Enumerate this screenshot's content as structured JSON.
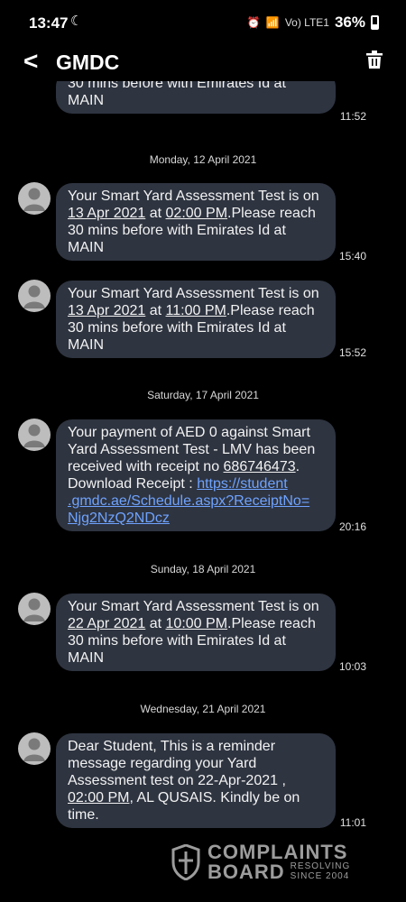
{
  "status": {
    "time": "13:47",
    "network": "Vo) LTE1",
    "battery": "36%"
  },
  "header": {
    "title": "GMDC"
  },
  "messages": [
    {
      "type": "message",
      "parts": [
        "30 mins before with Emirates Id at\nMAIN"
      ],
      "time": "11:52"
    },
    {
      "type": "date",
      "text": "Monday, 12 April 2021"
    },
    {
      "type": "message",
      "parts": [
        "Your Smart Yard Assessment Test is on\n",
        {
          "u": "13 Apr 2021"
        },
        "  at ",
        {
          "u": "02:00 PM"
        },
        ".Please reach\n30 mins before with Emirates Id at\nMAIN"
      ],
      "time": "15:40"
    },
    {
      "type": "message",
      "parts": [
        "Your Smart Yard Assessment Test is on\n",
        {
          "u": "13 Apr 2021"
        },
        "  at ",
        {
          "u": "11:00 PM"
        },
        ".Please reach\n30 mins before with Emirates Id at\nMAIN"
      ],
      "time": "15:52"
    },
    {
      "type": "date",
      "text": "Saturday, 17 April 2021"
    },
    {
      "type": "message",
      "parts": [
        "Your payment of AED 0 against Smart\nYard Assessment Test - LMV has been\nreceived with receipt no ",
        {
          "u": "686746473"
        },
        ".\nDownload Receipt : ",
        {
          "link": "https://student\n.gmdc.ae/Schedule.aspx?ReceiptNo=\nNjg2NzQ2NDcz"
        }
      ],
      "time": "20:16"
    },
    {
      "type": "date",
      "text": "Sunday, 18 April 2021"
    },
    {
      "type": "message",
      "parts": [
        "Your Smart Yard Assessment Test is on\n",
        {
          "u": "22 Apr 2021"
        },
        "  at ",
        {
          "u": "10:00 PM"
        },
        ".Please reach\n30 mins before with Emirates Id at\nMAIN"
      ],
      "time": "10:03"
    },
    {
      "type": "date",
      "text": "Wednesday, 21 April 2021"
    },
    {
      "type": "message",
      "parts": [
        "Dear Student, This is a reminder\nmessage regarding your Yard\nAssessment test on 22-Apr-2021 ,\n",
        {
          "u": "02:00 PM"
        },
        ", AL QUSAIS. Kindly be on\ntime."
      ],
      "time": "11:01"
    }
  ],
  "watermark": {
    "line1": "COMPLAINTS",
    "line2": "BOARD",
    "tag1": "RESOLVING",
    "tag2": "SINCE 2004"
  }
}
